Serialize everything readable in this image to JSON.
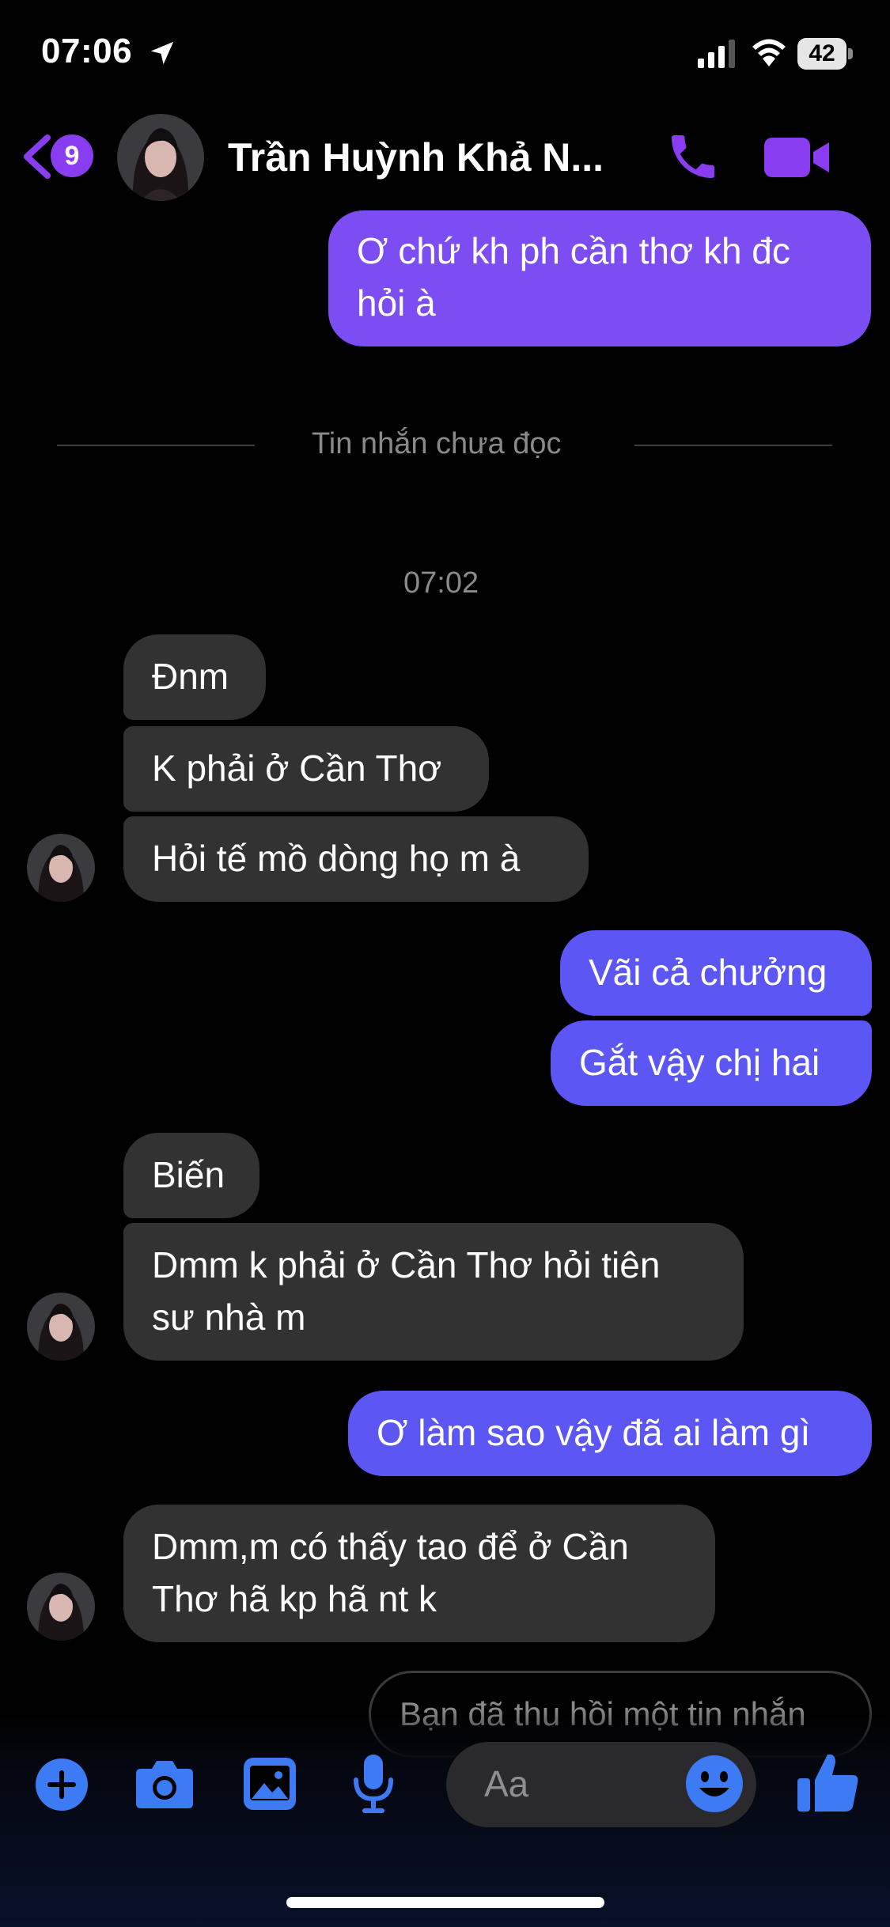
{
  "status_bar": {
    "time": "07:06",
    "battery": "42"
  },
  "header": {
    "back_badge": "9",
    "contact_name": "Trần Huỳnh Khả N..."
  },
  "messages": {
    "out_1": [
      "Ơ chứ kh ph cần thơ kh đc",
      "hỏi à"
    ],
    "unread_divider": "Tin nhắn chưa đọc",
    "timestamp": "07:02",
    "in_1": "Đnm",
    "in_2": "K phải ở Cần Thơ",
    "in_3": "Hỏi tế mồ dòng họ m à",
    "out_2": "Vãi cả chưởng",
    "out_3": "Gắt vậy chị hai",
    "in_4": "Biến",
    "in_5": [
      "Dmm k phải ở Cần Thơ hỏi tiên",
      "sư nhà m"
    ],
    "out_4": "Ơ làm sao vậy đã ai làm gì",
    "in_6": [
      "Dmm,m có thấy tao để ở Cần",
      "Thơ hã kp hã nt k"
    ],
    "recalled": "Bạn đã thu hồi một tin nhắn"
  },
  "composer": {
    "placeholder": "Aa",
    "icons": [
      "plus-icon",
      "camera-icon",
      "gallery-icon",
      "microphone-icon",
      "emoji-icon",
      "like-icon"
    ]
  },
  "colors": {
    "accent": "#8a3df0",
    "outgoing_bubble": "#5b56f4",
    "outgoing_bubble_top": "#7b4df2",
    "incoming_bubble": "#323232",
    "composer_icon": "#3d7bf5"
  }
}
